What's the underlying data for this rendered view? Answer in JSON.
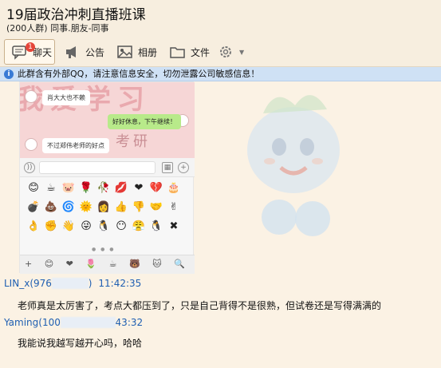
{
  "group": {
    "name": "19届政治冲刺直播班课",
    "meta": "(200人群) 同事.朋友-同事"
  },
  "toolbar": {
    "chat_label": "聊天",
    "chat_badge": "1",
    "announce_label": "公告",
    "album_label": "相册",
    "file_label": "文件"
  },
  "notice": {
    "text": "此群含有外部QQ，请注意信息安全，切勿泄露公司敏感信息！"
  },
  "screenshot": {
    "watermark_big": "我爱学习",
    "watermark_small": "考研",
    "bubble1": "肖大大也不赖",
    "bubble2": "好好休息，下午继续！",
    "bubble3": "不过郑伟老师的好点",
    "emoji_row1": [
      "😊",
      "☕",
      "🐷",
      "🌹",
      "🥀",
      "💋",
      "❤",
      "💔",
      "🎂"
    ],
    "emoji_row2": [
      "💣",
      "💩",
      "🌀",
      "🌞",
      "👩",
      "👍",
      "👎",
      "🤝",
      "✌"
    ],
    "emoji_row3": [
      "👌",
      "✊",
      "👋",
      "😜",
      "🐧",
      "😶",
      "😤",
      "🐧",
      "✖"
    ],
    "bottom_bar": "+ 😊 ❤ 🌷 ☕ 🐻 🐱 🔍"
  },
  "messages": [
    {
      "sender": "LIN_x",
      "qq_partial": "(976",
      "qq_tail": ")",
      "time": "11:42:35",
      "text": "老师真是太厉害了，考点大都压到了，只是自己背得不是很熟，但试卷还是写得满满的"
    },
    {
      "sender": "Yaming",
      "qq_partial": "(100",
      "qq_tail": "",
      "time": "43:32",
      "text": "我能说我越写越开心吗，哈哈"
    }
  ],
  "colors": {
    "name_link": "#1f5fb2",
    "notice_bg": "#cfe1f5",
    "badge": "#e5463a"
  }
}
